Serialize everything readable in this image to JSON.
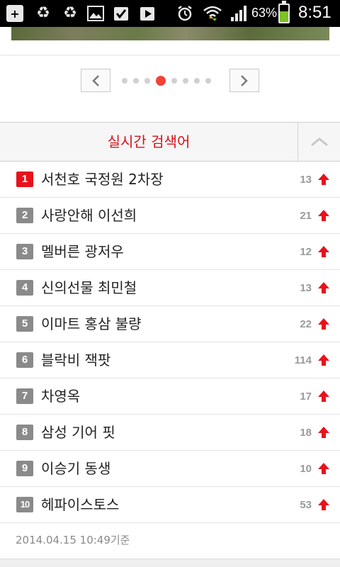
{
  "status_bar": {
    "battery_percent": "63%",
    "battery_level": 0.63,
    "time": "8:51",
    "icons": [
      "add-icon",
      "recycle-icon",
      "recycle-icon",
      "image-icon",
      "check-icon",
      "play-icon",
      "alarm-icon",
      "wifi-icon",
      "signal-icon",
      "battery-icon"
    ]
  },
  "pager": {
    "page_count": 8,
    "active_index": 3,
    "active_color": "#f04436"
  },
  "trending": {
    "title": "실시간 검색어",
    "title_color": "#d8121a",
    "items": [
      {
        "rank": "1",
        "keyword": "서천호 국정원 2차장",
        "count": "13"
      },
      {
        "rank": "2",
        "keyword": "사랑안해 이선희",
        "count": "21"
      },
      {
        "rank": "3",
        "keyword": "멜버른 광저우",
        "count": "12"
      },
      {
        "rank": "4",
        "keyword": "신의선물 최민철",
        "count": "13"
      },
      {
        "rank": "5",
        "keyword": "이마트 홍삼 불량",
        "count": "22"
      },
      {
        "rank": "6",
        "keyword": "블락비 잭팟",
        "count": "114"
      },
      {
        "rank": "7",
        "keyword": "차영옥",
        "count": "17"
      },
      {
        "rank": "8",
        "keyword": "삼성 기어 핏",
        "count": "18"
      },
      {
        "rank": "9",
        "keyword": "이승기 동생",
        "count": "10"
      },
      {
        "rank": "10",
        "keyword": "헤파이스토스",
        "count": "53"
      }
    ],
    "timestamp": "2014.04.15 10:49기준"
  }
}
